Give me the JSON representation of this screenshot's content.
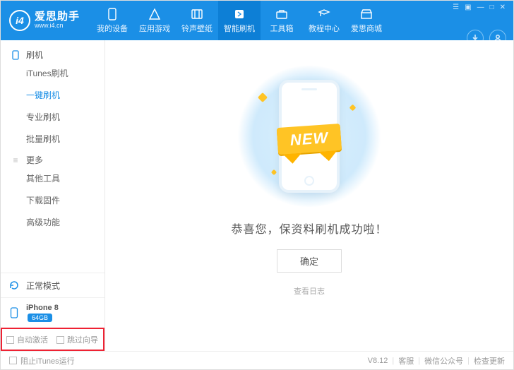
{
  "header": {
    "logo_badge": "i4",
    "title": "爱思助手",
    "url": "www.i4.cn",
    "tabs": [
      {
        "label": "我的设备"
      },
      {
        "label": "应用游戏"
      },
      {
        "label": "铃声壁纸"
      },
      {
        "label": "智能刷机"
      },
      {
        "label": "工具箱"
      },
      {
        "label": "教程中心"
      },
      {
        "label": "爱思商城"
      }
    ]
  },
  "sidebar": {
    "group1": "刷机",
    "items1": [
      "iTunes刷机",
      "一键刷机",
      "专业刷机",
      "批量刷机"
    ],
    "group2": "更多",
    "items2": [
      "其他工具",
      "下载固件",
      "高级功能"
    ],
    "mode": "正常模式",
    "device": "iPhone 8",
    "storage": "64GB",
    "auto_activate": "自动激活",
    "skip_guide": "跳过向导"
  },
  "main": {
    "ribbon": "NEW",
    "message": "恭喜您，保资料刷机成功啦！",
    "ok": "确定",
    "view_log": "查看日志"
  },
  "status": {
    "block_itunes": "阻止iTunes运行",
    "version": "V8.12",
    "support": "客服",
    "wechat": "微信公众号",
    "update": "检查更新"
  }
}
